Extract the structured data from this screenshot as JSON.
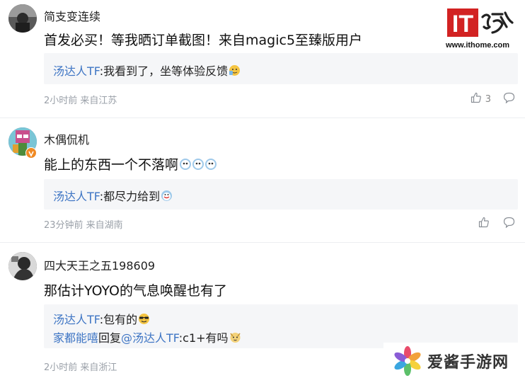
{
  "watermarks": {
    "ithome_logo": "IT之家",
    "ithome_url": "www.ithome.com",
    "aijiang_text": "爱酱手游网"
  },
  "comments": [
    {
      "username": "简支变连续",
      "content": "首发必买！等我晒订单截图！来自magic5至臻版用户",
      "replies": [
        {
          "name": "汤达人TF",
          "text": ":我看到了，坐等体验反馈"
        }
      ],
      "meta": "2小时前 来自江苏",
      "likes": "3"
    },
    {
      "username": "木偶侃机",
      "content": "能上的东西一个不落啊",
      "replies": [
        {
          "name": "汤达人TF",
          "text": ":都尽力给到"
        }
      ],
      "meta": "23分钟前 来自湖南",
      "likes": ""
    },
    {
      "username": "四大天王之五198609",
      "content": "那估计YOYO的气息唤醒也有了",
      "replies": [
        {
          "name": "汤达人TF",
          "text": ":包有的"
        },
        {
          "name": "家都能嘻",
          "text_prefix": "回复",
          "mention": "@汤达人TF",
          "text": ":c1+有吗"
        }
      ],
      "meta": "2小时前 来自浙江",
      "likes": ""
    }
  ],
  "icons": {
    "like": "thumbs-up-icon",
    "reply": "speech-bubble-icon"
  },
  "colors": {
    "link": "#3e75c4",
    "meta": "#9aa0a8",
    "reply_bg": "#f5f6f8",
    "ithome_red": "#d22222"
  }
}
